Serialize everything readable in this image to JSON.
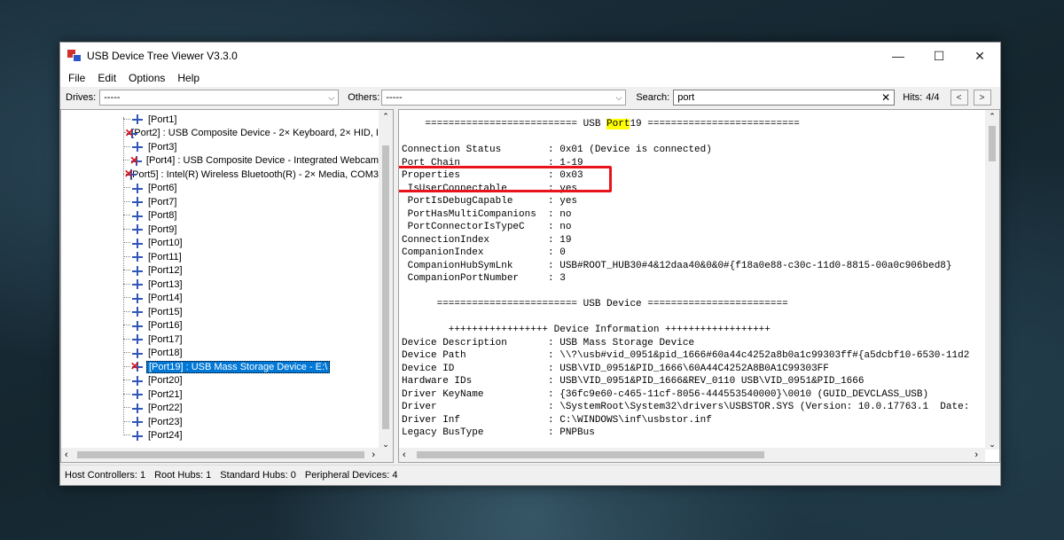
{
  "window": {
    "title": "USB Device Tree Viewer V3.3.0",
    "controls": {
      "minimize": "—",
      "maximize": "☐",
      "close": "✕"
    }
  },
  "menu": [
    "File",
    "Edit",
    "Options",
    "Help"
  ],
  "toolbar": {
    "drives_label": "Drives:",
    "drives_value": "-----",
    "others_label": "Others:",
    "others_value": "-----",
    "search_label": "Search:",
    "search_value": "port",
    "hits_label": "Hits:",
    "hits_value": "4/4",
    "prev": "<",
    "next": ">"
  },
  "tree": {
    "items": [
      {
        "label": "[Port1]",
        "error": false
      },
      {
        "label": "[Port2] : USB Composite Device - 2× Keyboard, 2× HID, I",
        "error": true
      },
      {
        "label": "[Port3]",
        "error": false
      },
      {
        "label": "[Port4] : USB Composite Device - Integrated Webcam",
        "error": true
      },
      {
        "label": "[Port5] : Intel(R) Wireless Bluetooth(R) - 2× Media, COM3",
        "error": true
      },
      {
        "label": "[Port6]",
        "error": false
      },
      {
        "label": "[Port7]",
        "error": false
      },
      {
        "label": "[Port8]",
        "error": false
      },
      {
        "label": "[Port9]",
        "error": false
      },
      {
        "label": "[Port10]",
        "error": false
      },
      {
        "label": "[Port11]",
        "error": false
      },
      {
        "label": "[Port12]",
        "error": false
      },
      {
        "label": "[Port13]",
        "error": false
      },
      {
        "label": "[Port14]",
        "error": false
      },
      {
        "label": "[Port15]",
        "error": false
      },
      {
        "label": "[Port16]",
        "error": false
      },
      {
        "label": "[Port17]",
        "error": false
      },
      {
        "label": "[Port18]",
        "error": false
      },
      {
        "label": "[Port19] : USB Mass Storage Device - E:\\",
        "error": true,
        "selected": true
      },
      {
        "label": "[Port20]",
        "error": false
      },
      {
        "label": "[Port21]",
        "error": false
      },
      {
        "label": "[Port22]",
        "error": false
      },
      {
        "label": "[Port23]",
        "error": false
      },
      {
        "label": "[Port24]",
        "error": false
      }
    ]
  },
  "detail": {
    "header_pre": "    ========================== USB ",
    "header_hl": "Port",
    "header_post": "19 ==========================",
    "lines": [
      "",
      "Connection Status        : 0x01 (Device is connected)",
      "Port Chain               : 1-19",
      "Properties               : 0x03",
      " IsUserConnectable       : yes",
      " PortIsDebugCapable      : yes",
      " PortHasMultiCompanions  : no",
      " PortConnectorIsTypeC    : no",
      "ConnectionIndex          : 19",
      "CompanionIndex           : 0",
      " CompanionHubSymLnk      : USB#ROOT_HUB30#4&12daa40&0&0#{f18a0e88-c30c-11d0-8815-00a0c906bed8}",
      " CompanionPortNumber     : 3",
      "",
      "      ======================== USB Device ========================",
      "",
      "        +++++++++++++++++ Device Information ++++++++++++++++++",
      "Device Description       : USB Mass Storage Device",
      "Device Path              : \\\\?\\usb#vid_0951&pid_1666#60a44c4252a8b0a1c99303ff#{a5dcbf10-6530-11d2",
      "Device ID                : USB\\VID_0951&PID_1666\\60A44C4252A8B0A1C99303FF",
      "Hardware IDs             : USB\\VID_0951&PID_1666&REV_0110 USB\\VID_0951&PID_1666",
      "Driver KeyName           : {36fc9e60-c465-11cf-8056-444553540000}\\0010 (GUID_DEVCLASS_USB)",
      "Driver                   : \\SystemRoot\\System32\\drivers\\USBSTOR.SYS (Version: 10.0.17763.1  Date:",
      "Driver Inf               : C:\\WINDOWS\\inf\\usbstor.inf",
      "Legacy BusType           : PNPBus"
    ]
  },
  "status": {
    "host_controllers": "Host Controllers: 1",
    "root_hubs": "Root Hubs: 1",
    "standard_hubs": "Standard Hubs: 0",
    "peripheral_devices": "Peripheral Devices: 4"
  },
  "colors": {
    "selection": "#0078d7",
    "highlight": "#ffff00",
    "annotation_box": "#e8131b"
  }
}
